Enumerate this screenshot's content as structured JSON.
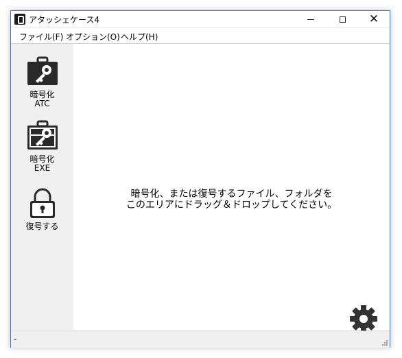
{
  "window": {
    "title": "アタッシェケース4",
    "buttons": {
      "minimize": "minimize-icon",
      "maximize": "maximize-icon",
      "close": "close-icon"
    }
  },
  "menu": [
    {
      "label": "ファイル(F)"
    },
    {
      "label": "オプション(O)"
    },
    {
      "label": "ヘルプ(H)"
    }
  ],
  "sidebar": {
    "items": [
      {
        "label_line1": "暗号化",
        "label_line2": "ATC",
        "icon": "briefcase-key-icon"
      },
      {
        "label_line1": "暗号化",
        "label_line2": "EXE",
        "icon": "briefcase-key-exe-icon"
      },
      {
        "label_line1": "復号する",
        "label_line2": "",
        "icon": "padlock-icon"
      }
    ]
  },
  "dropzone": {
    "line1": "暗号化、または復号するファイル、フォルダを",
    "line2": "このエリアにドラッグ＆ドロップしてください。",
    "settings_icon": "gear-icon"
  },
  "statusbar": {
    "text": "-"
  },
  "colors": {
    "accent": "#2b79d0",
    "sidebar_bg": "#f0f0f0",
    "icon_dark": "#2a2a2a"
  }
}
